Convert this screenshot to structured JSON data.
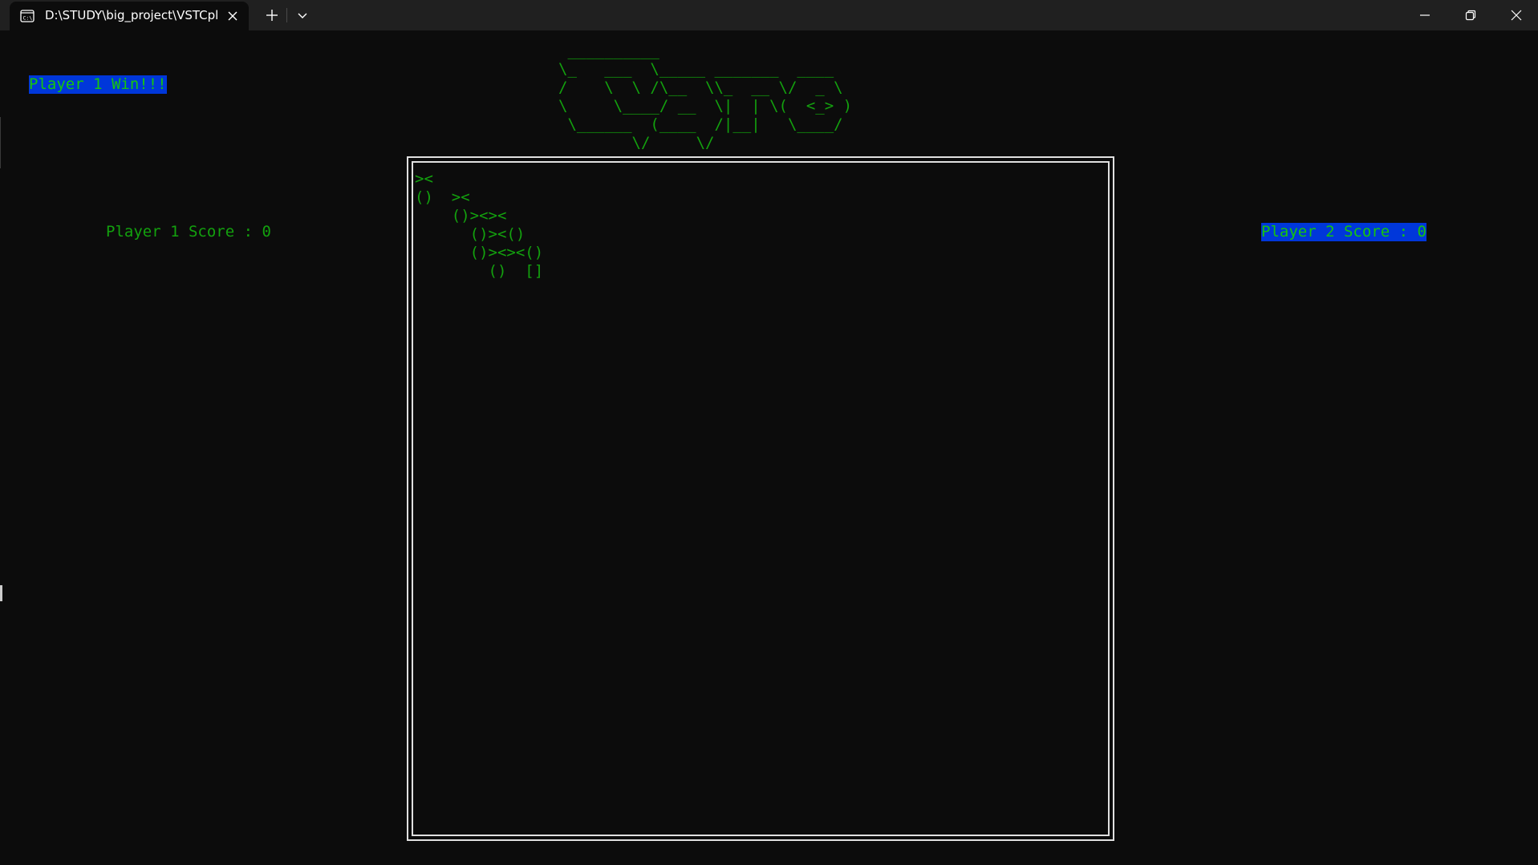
{
  "window": {
    "tab_title": "D:\\STUDY\\big_project\\VSTCpl",
    "icons": {
      "tab_icon": "terminal-icon",
      "close": "close-icon",
      "new_tab": "plus-icon",
      "dropdown": "chevron-down-icon",
      "minimize": "minimize-icon",
      "maximize": "restore-icon",
      "window_close": "close-icon"
    }
  },
  "game": {
    "win_message": "Player 1 Win!!!",
    "player1_score": "Player 1 Score : 0",
    "player2_score": "Player 2 Score : 0",
    "logo_ascii": " __________\n\\_   ___  \\_____ _______  ____\n/    \\  \\ /\\__  \\\\_  __ \\/  _ \\\n\\     \\____/ __  \\|  | \\(  <_> )\n \\______  (____  /|__|   \\____/\n        \\/     \\/",
    "board_ascii": "><\n()  ><\n    ()><><\n      ()><()\n      ()><><()\n        ()  []"
  },
  "colors": {
    "background": "#0c0c0c",
    "titlebar": "#202020",
    "text_green": "#13a10e",
    "highlight_bg": "#0037da",
    "border": "#e0e0e0"
  }
}
